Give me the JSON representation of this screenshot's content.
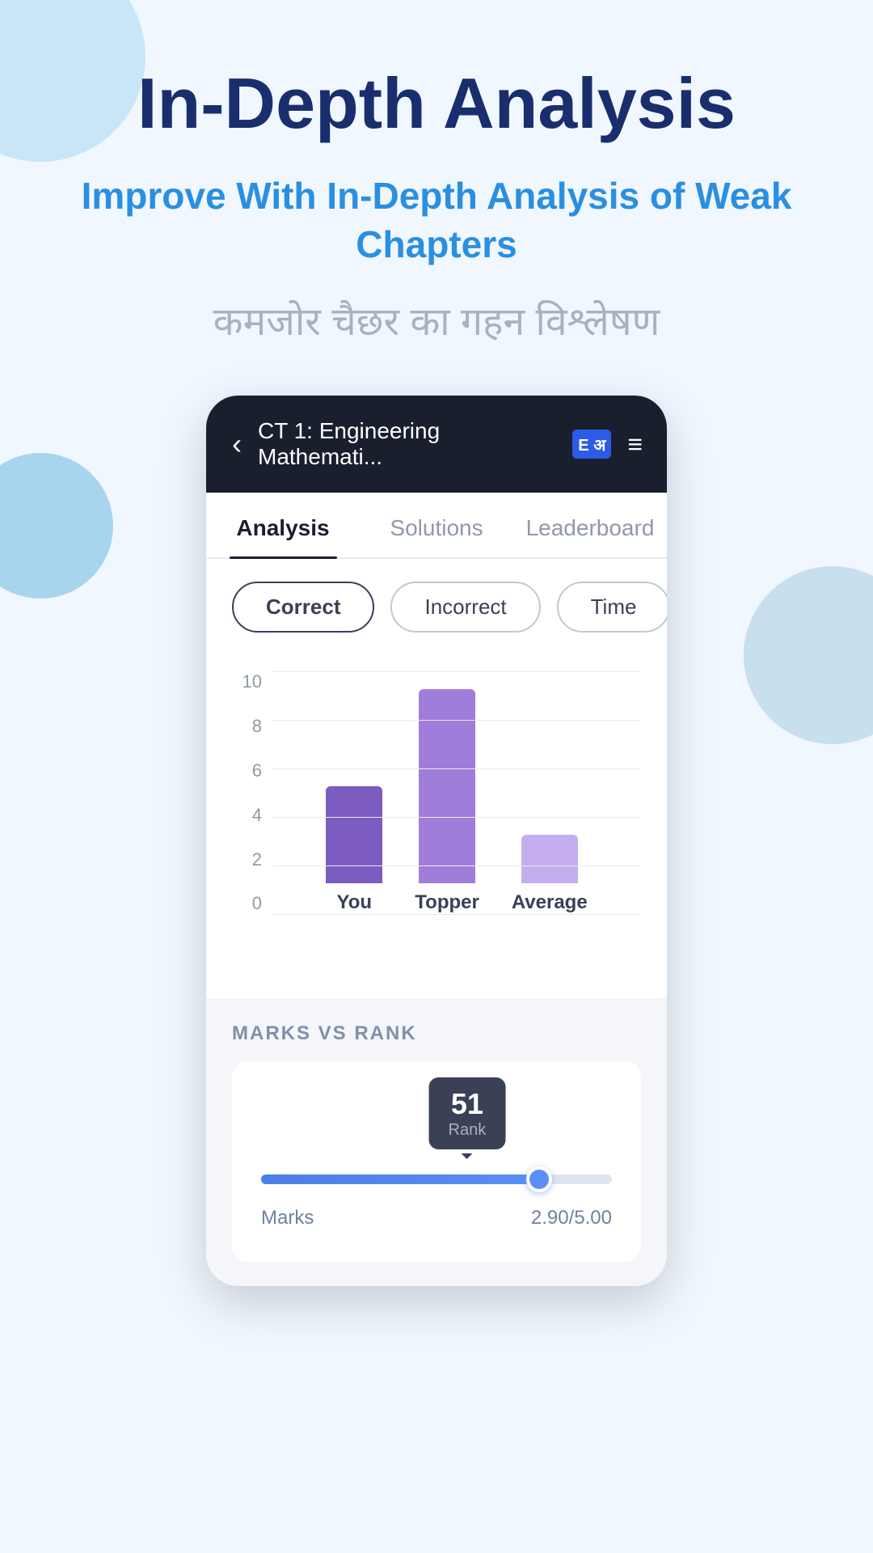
{
  "page": {
    "main_title": "In-Depth Analysis",
    "subtitle_english": "Improve With In-Depth Analysis of Weak Chapters",
    "subtitle_hindi": "कमजोर चैछर का गहन विश्लेषण"
  },
  "navbar": {
    "back_icon": "‹",
    "title": "CT 1: Engineering Mathemati...",
    "book_label": "E अ",
    "menu_icon": "≡"
  },
  "tabs": [
    {
      "label": "Analysis",
      "active": true
    },
    {
      "label": "Solutions",
      "active": false
    },
    {
      "label": "Leaderboard",
      "active": false
    }
  ],
  "filters": [
    {
      "label": "Correct",
      "active": true
    },
    {
      "label": "Incorrect",
      "active": false
    },
    {
      "label": "Time",
      "active": false
    }
  ],
  "chart": {
    "y_labels": [
      "10",
      "8",
      "6",
      "4",
      "2",
      "0"
    ],
    "bars": [
      {
        "label": "You",
        "height_pct": 40
      },
      {
        "label": "Topper",
        "height_pct": 80
      },
      {
        "label": "Average",
        "height_pct": 20
      }
    ]
  },
  "marks_vs_rank": {
    "section_title": "MARKS VS RANK",
    "rank_number": "51",
    "rank_label": "Rank",
    "slider_fill_pct": 82,
    "marks_label": "Marks",
    "marks_value": "2.90/5.00"
  }
}
